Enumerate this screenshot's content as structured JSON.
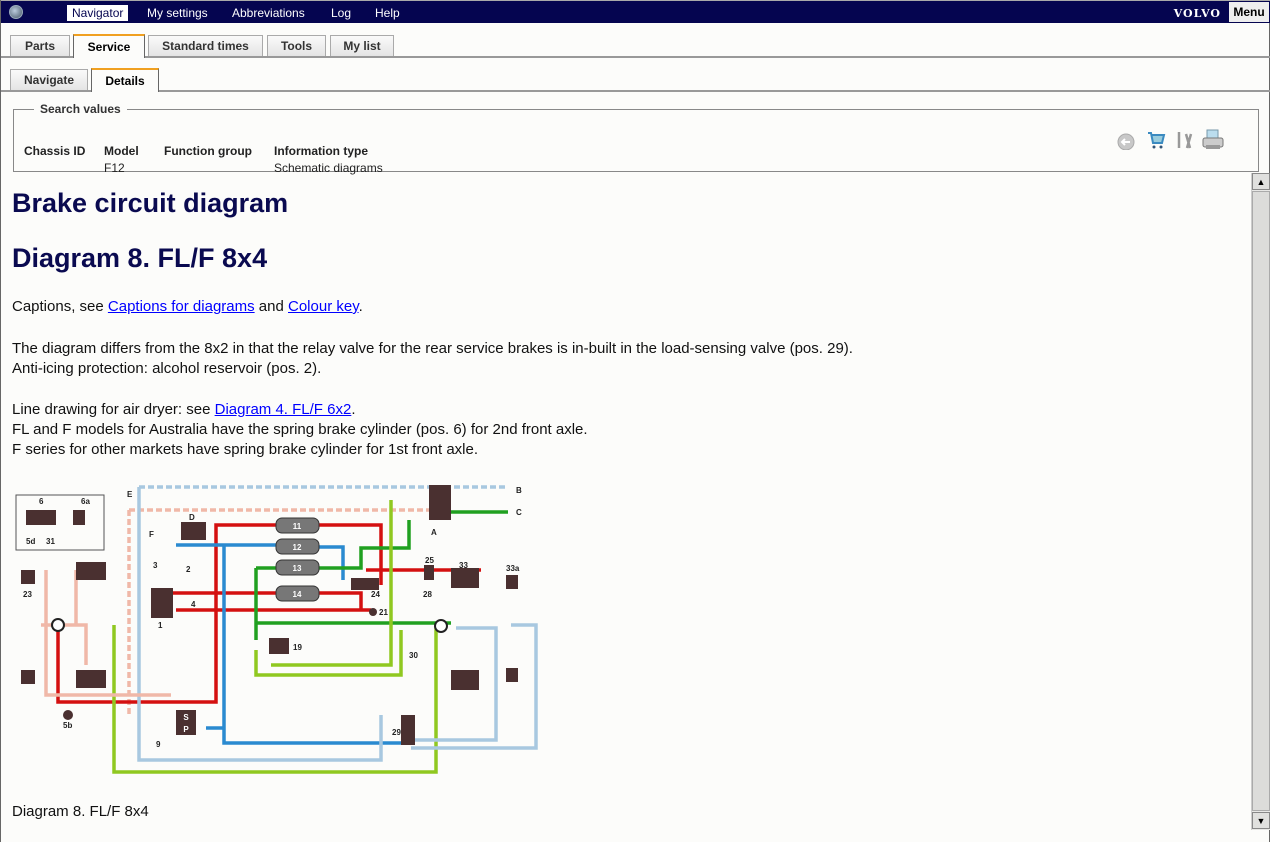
{
  "topbar": {
    "menu": [
      "Navigator",
      "My settings",
      "Abbreviations",
      "Log",
      "Help"
    ],
    "active": "Navigator",
    "brand": "VOLVO",
    "menu_button": "Menu"
  },
  "main_tabs": [
    {
      "label": "Parts"
    },
    {
      "label": "Service",
      "active": true
    },
    {
      "label": "Standard times"
    },
    {
      "label": "Tools"
    },
    {
      "label": "My list"
    }
  ],
  "sub_tabs": [
    {
      "label": "Navigate"
    },
    {
      "label": "Details",
      "active": true
    }
  ],
  "search_values": {
    "legend": "Search values",
    "fields": [
      {
        "label": "Chassis ID",
        "value": ""
      },
      {
        "label": "Model",
        "value": "F12"
      },
      {
        "label": "Function group",
        "value": ""
      },
      {
        "label": "Information type",
        "value": "Schematic diagrams"
      }
    ]
  },
  "toolbar_icons": [
    "back-icon",
    "cart-icon",
    "tools-icon",
    "printer-icon"
  ],
  "content": {
    "title": "Brake circuit diagram",
    "subtitle": "Diagram 8. FL/F 8x4",
    "captions_prefix": "Captions, see ",
    "captions_link": "Captions for diagrams",
    "captions_and": " and ",
    "colour_link": "Colour key",
    "captions_end": ".",
    "para1_line1": "The diagram differs from the 8x2 in that the relay valve for the rear service brakes is in-built in the load-sensing valve (pos. 29).",
    "para1_line2": "Anti-icing protection: alcohol reservoir (pos. 2).",
    "para2_prefix": "Line drawing for air dryer: see ",
    "para2_link": "Diagram 4. FL/F 6x2",
    "para2_end": ".",
    "para2_line2": "FL and F models for Australia have the spring brake cylinder (pos. 6) for 2nd front axle.",
    "para2_line3": "F series for other markets have spring brake cylinder for 1st front axle.",
    "figure_caption": "Diagram 8. FL/F 8x4"
  },
  "diagram_labels": {
    "tanks": [
      "11",
      "12",
      "13",
      "14"
    ],
    "other": [
      "6",
      "6a",
      "5d",
      "31",
      "23",
      "S",
      "P",
      "A",
      "B",
      "C",
      "D",
      "E",
      "F",
      "1",
      "2",
      "3",
      "4",
      "24",
      "29",
      "30",
      "33",
      "33a",
      "5b",
      "9",
      "19",
      "21",
      "25",
      "28"
    ]
  },
  "colors": {
    "topbar": "#050550",
    "heading": "#0a0a50",
    "tab_accent": "#f0a020",
    "red": "#d41010",
    "blue": "#2a8ad0",
    "green": "#20a020",
    "lightgreen": "#90c820",
    "pink": "#f0b8a8",
    "lightblue": "#a8c8e0",
    "component": "#4a3030"
  }
}
